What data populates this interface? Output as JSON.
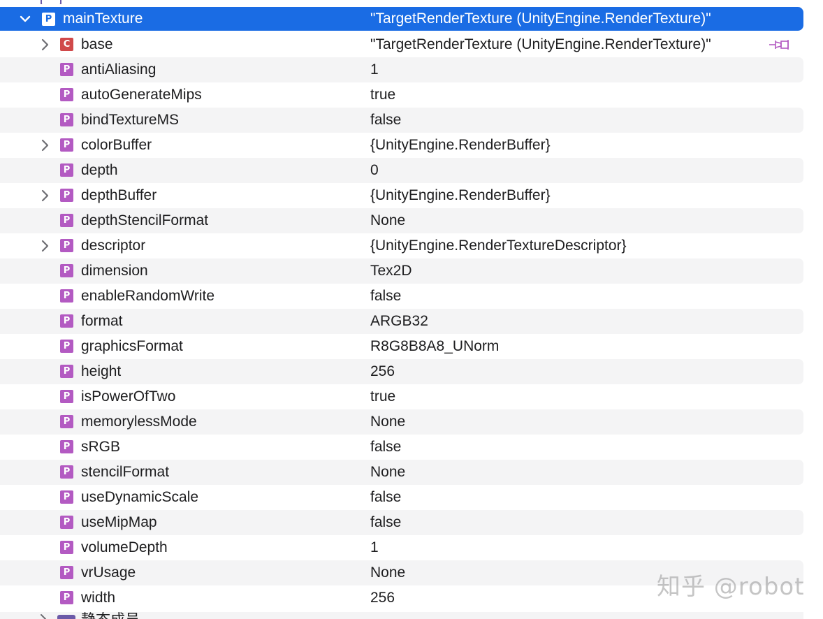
{
  "selected_row": {
    "expanded": true,
    "badge": "P",
    "name": "mainTexture",
    "value": "\"TargetRenderTexture (UnityEngine.RenderTexture)\""
  },
  "rows": [
    {
      "badge": "C",
      "badge_kind": "class",
      "expandable": true,
      "name": "base",
      "value": "\"TargetRenderTexture (UnityEngine.RenderTexture)\"",
      "pinned": true
    },
    {
      "badge": "P",
      "badge_kind": "property",
      "expandable": false,
      "name": "antiAliasing",
      "value": "1"
    },
    {
      "badge": "P",
      "badge_kind": "property",
      "expandable": false,
      "name": "autoGenerateMips",
      "value": "true"
    },
    {
      "badge": "P",
      "badge_kind": "property",
      "expandable": false,
      "name": "bindTextureMS",
      "value": "false"
    },
    {
      "badge": "P",
      "badge_kind": "property",
      "expandable": true,
      "name": "colorBuffer",
      "value": "{UnityEngine.RenderBuffer}"
    },
    {
      "badge": "P",
      "badge_kind": "property",
      "expandable": false,
      "name": "depth",
      "value": "0"
    },
    {
      "badge": "P",
      "badge_kind": "property",
      "expandable": true,
      "name": "depthBuffer",
      "value": "{UnityEngine.RenderBuffer}"
    },
    {
      "badge": "P",
      "badge_kind": "property",
      "expandable": false,
      "name": "depthStencilFormat",
      "value": "None"
    },
    {
      "badge": "P",
      "badge_kind": "property",
      "expandable": true,
      "name": "descriptor",
      "value": "{UnityEngine.RenderTextureDescriptor}"
    },
    {
      "badge": "P",
      "badge_kind": "property",
      "expandable": false,
      "name": "dimension",
      "value": "Tex2D"
    },
    {
      "badge": "P",
      "badge_kind": "property",
      "expandable": false,
      "name": "enableRandomWrite",
      "value": "false"
    },
    {
      "badge": "P",
      "badge_kind": "property",
      "expandable": false,
      "name": "format",
      "value": "ARGB32"
    },
    {
      "badge": "P",
      "badge_kind": "property",
      "expandable": false,
      "name": "graphicsFormat",
      "value": "R8G8B8A8_UNorm"
    },
    {
      "badge": "P",
      "badge_kind": "property",
      "expandable": false,
      "name": "height",
      "value": "256"
    },
    {
      "badge": "P",
      "badge_kind": "property",
      "expandable": false,
      "name": "isPowerOfTwo",
      "value": "true"
    },
    {
      "badge": "P",
      "badge_kind": "property",
      "expandable": false,
      "name": "memorylessMode",
      "value": "None"
    },
    {
      "badge": "P",
      "badge_kind": "property",
      "expandable": false,
      "name": "sRGB",
      "value": "false"
    },
    {
      "badge": "P",
      "badge_kind": "property",
      "expandable": false,
      "name": "stencilFormat",
      "value": "None"
    },
    {
      "badge": "P",
      "badge_kind": "property",
      "expandable": false,
      "name": "useDynamicScale",
      "value": "false"
    },
    {
      "badge": "P",
      "badge_kind": "property",
      "expandable": false,
      "name": "useMipMap",
      "value": "false"
    },
    {
      "badge": "P",
      "badge_kind": "property",
      "expandable": false,
      "name": "volumeDepth",
      "value": "1"
    },
    {
      "badge": "P",
      "badge_kind": "property",
      "expandable": false,
      "name": "vrUsage",
      "value": "None"
    },
    {
      "badge": "P",
      "badge_kind": "property",
      "expandable": false,
      "name": "width",
      "value": "256"
    }
  ],
  "bottom_partial_label": "静态成员",
  "watermark": "知乎 @robot",
  "colors": {
    "selection": "#1a6ce4",
    "property_badge": "#b35ac2",
    "class_badge": "#d0494a",
    "zebra": "#f4f4f5",
    "pin": "#b35ac2"
  },
  "icons": {
    "expand": "chevron-right-icon",
    "collapse": "chevron-down-icon",
    "pin": "pin-icon",
    "folder": "folder-icon"
  }
}
